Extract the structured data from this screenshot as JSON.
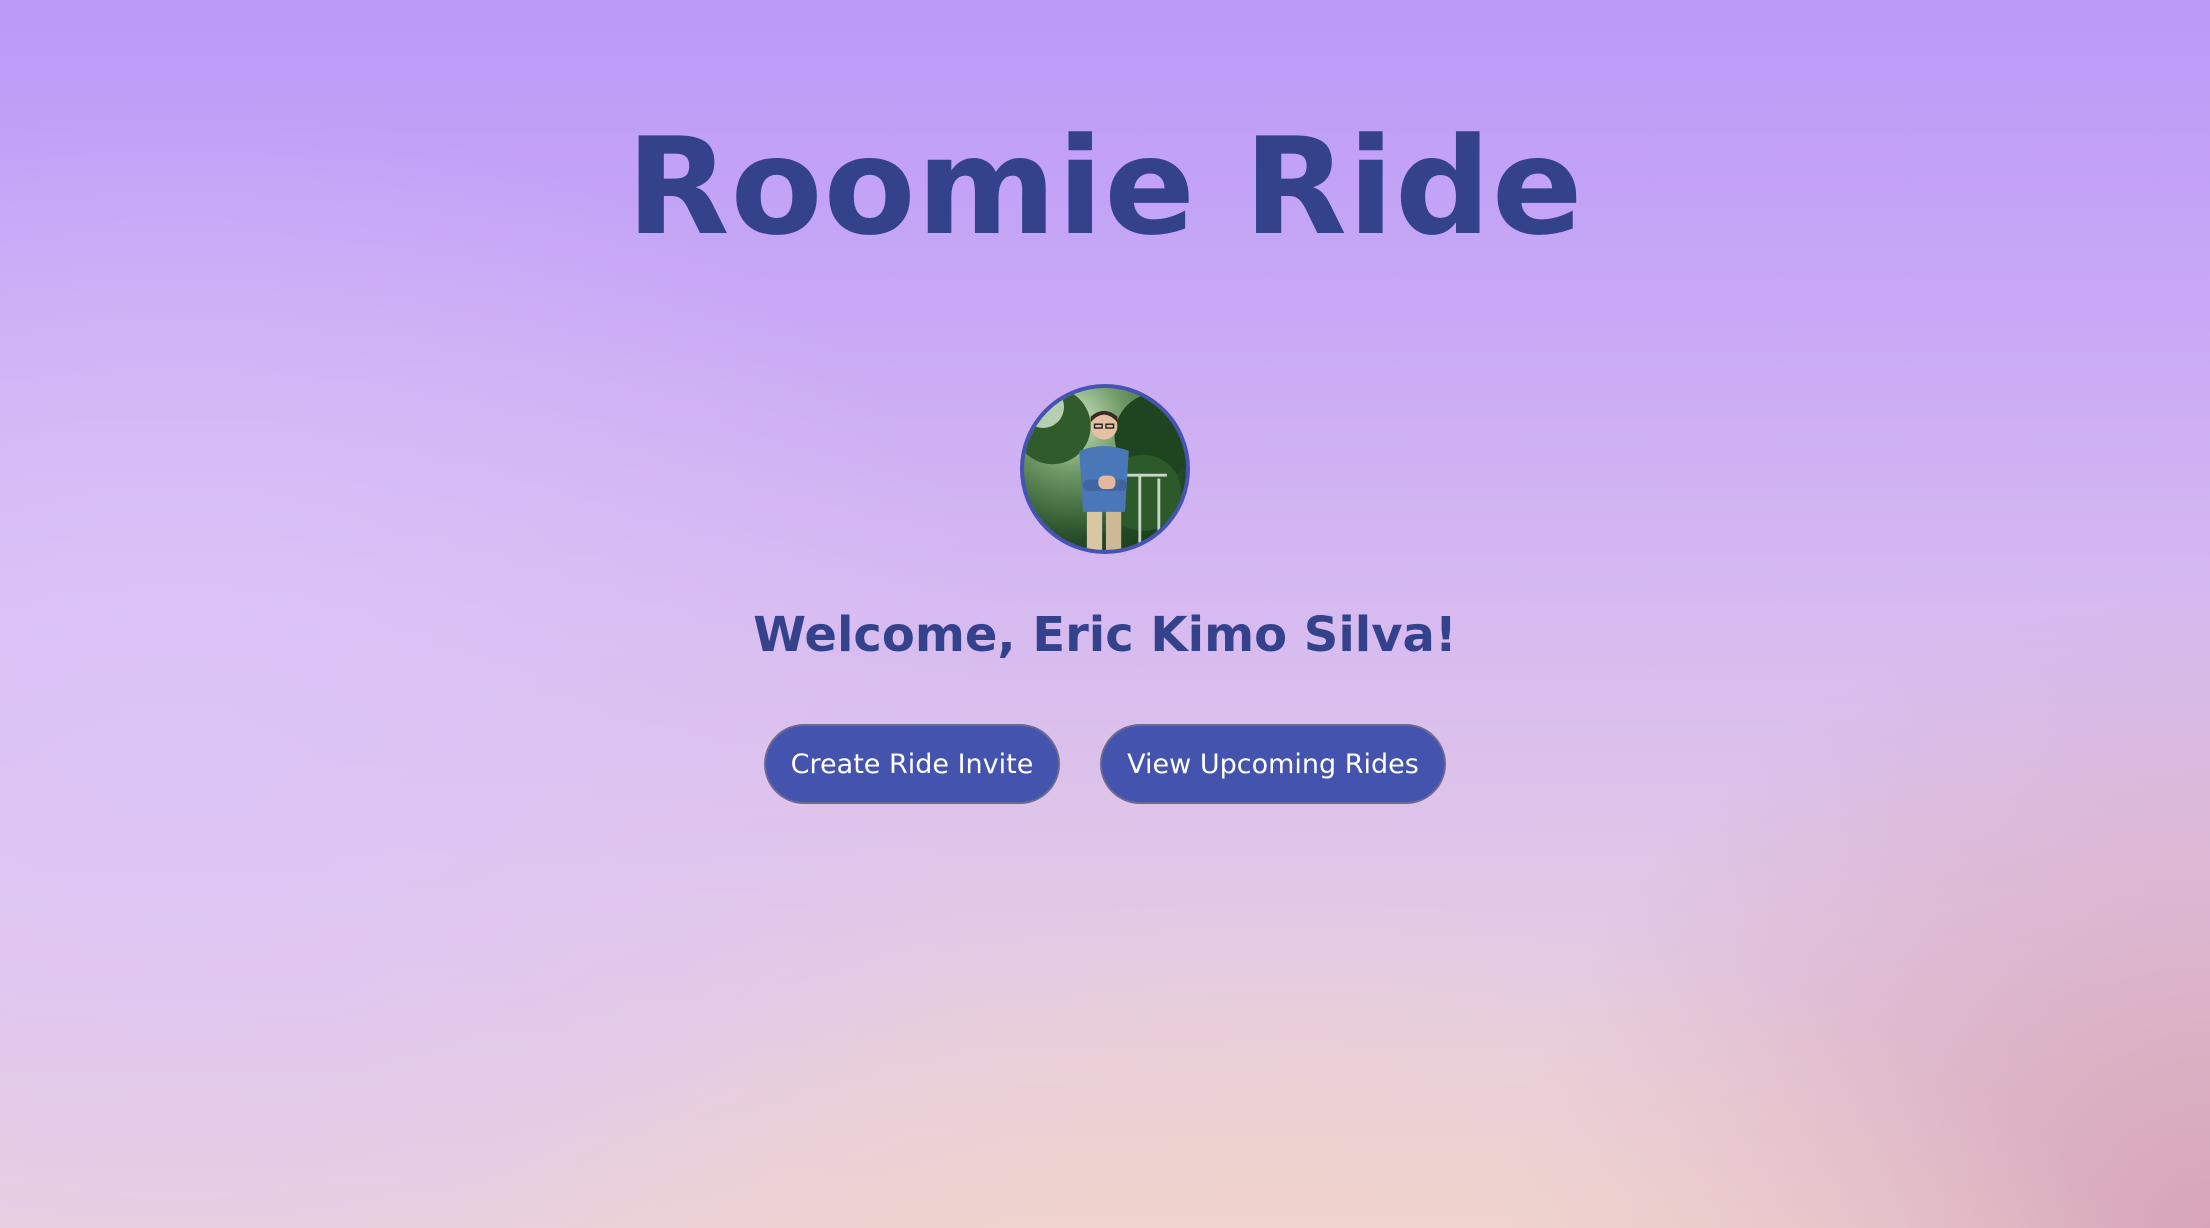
{
  "header": {
    "title": "Roomie Ride"
  },
  "profile": {
    "avatar_icon": "user-photo",
    "welcome_text": "Welcome, Eric Kimo Silva!"
  },
  "actions": {
    "create_label": "Create Ride Invite",
    "upcoming_label": "View Upcoming Rides"
  },
  "colors": {
    "accent": "#4454ae",
    "title_text": "#34428c",
    "background_top": "#bb9af8",
    "background_bottom": "#f1d3c8"
  }
}
